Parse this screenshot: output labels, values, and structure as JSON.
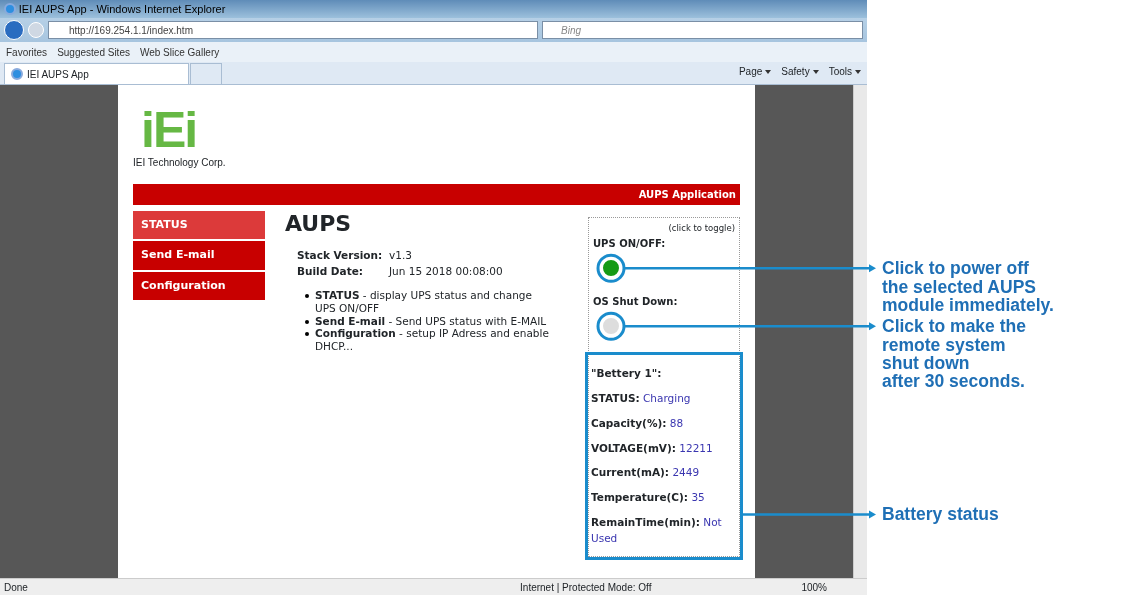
{
  "window": {
    "title": "IEI AUPS App - Windows Internet Explorer"
  },
  "address_bar": {
    "url": "http://169.254.1.1/index.htm",
    "search_placeholder": "Bing"
  },
  "favorites_bar": {
    "favorites": "Favorites",
    "links": [
      "Suggested Sites",
      "Web Slice Gallery"
    ]
  },
  "tabs": [
    {
      "label": "IEI AUPS App",
      "selected": true
    }
  ],
  "command_bar": [
    "Page",
    "Safety",
    "Tools"
  ],
  "page": {
    "logo_text": "iEi",
    "company": "IEI Technology Corp.",
    "banner": "AUPS Application",
    "menu": [
      {
        "label": "STATUS",
        "selected": true
      },
      {
        "label": "Send E-mail",
        "selected": false
      },
      {
        "label": "Configuration",
        "selected": false
      }
    ],
    "heading": "AUPS",
    "info": [
      {
        "label": "Stack Version:",
        "value": "v1.3"
      },
      {
        "label": "Build Date:",
        "value": "Jun 15 2018 00:08:00"
      }
    ],
    "features": [
      "**STATUS** - display UPS status and change UPS ON/OFF",
      "**Send E-mail** - Send UPS status with E-MAIL",
      "**Configuration** - setup IP Adress and enable DHCP..."
    ],
    "panel": {
      "hint": "(click to toggle)",
      "toggles": [
        {
          "label": "UPS ON/OFF:",
          "on": true
        },
        {
          "label": "OS Shut Down:",
          "on": false
        }
      ],
      "battery": {
        "title": "\"Bettery 1\":",
        "fields": [
          {
            "label": "STATUS:",
            "value": "Charging"
          },
          {
            "label": "Capacity(%):",
            "value": "88"
          },
          {
            "label": "VOLTAGE(mV):",
            "value": "12211"
          },
          {
            "label": "Current(mA):",
            "value": "2449"
          },
          {
            "label": "Temperature(C):",
            "value": "35"
          },
          {
            "label": "RemainTime(min):",
            "value": "Not Used"
          }
        ]
      }
    }
  },
  "status_bar": {
    "text": "Done",
    "zone": "Internet | Protected Mode: Off",
    "zoom": "100%"
  },
  "annotations": [
    "Click to power off\nthe selected AUPS\nmodule immediately.",
    "Click to make the\nremote system\nshut down\nafter 30 seconds.",
    "Battery status"
  ]
}
